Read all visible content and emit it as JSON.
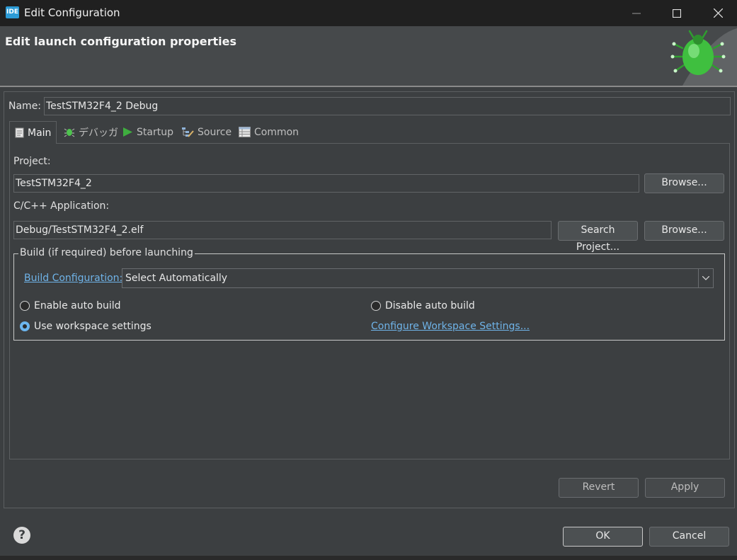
{
  "window": {
    "title": "Edit Configuration",
    "app_icon_text": "IDE"
  },
  "header": {
    "title": "Edit launch configuration properties"
  },
  "name_field": {
    "label": "Name:",
    "value": "TestSTM32F4_2 Debug"
  },
  "tabs": [
    {
      "label": "Main",
      "icon": "document-icon"
    },
    {
      "label": "デバッガ",
      "icon": "debugger-icon"
    },
    {
      "label": "Startup",
      "icon": "play-icon"
    },
    {
      "label": "Source",
      "icon": "source-icon"
    },
    {
      "label": "Common",
      "icon": "table-icon"
    }
  ],
  "main_tab": {
    "project_label": "Project:",
    "project_value": "TestSTM32F4_2",
    "project_browse": "Browse...",
    "app_label": "C/C++ Application:",
    "app_value": "Debug/TestSTM32F4_2.elf",
    "search_project": "Search Project...",
    "app_browse": "Browse...",
    "build_group": {
      "title": "Build (if required) before launching",
      "config_link": "Build Configuration:",
      "config_value": "Select Automatically",
      "enable_auto": "Enable auto build",
      "disable_auto": "Disable auto build",
      "use_workspace": "Use workspace settings",
      "configure_link": "Configure Workspace Settings...",
      "selected": "use_workspace"
    }
  },
  "panel_buttons": {
    "revert": "Revert",
    "apply": "Apply"
  },
  "dialog_buttons": {
    "ok": "OK",
    "cancel": "Cancel",
    "help": "?"
  },
  "colors": {
    "background": "#3c3f41",
    "link": "#6fb3e8",
    "radio_selected": "#6cb6ef",
    "accent_bug": "#3fbf3f"
  }
}
